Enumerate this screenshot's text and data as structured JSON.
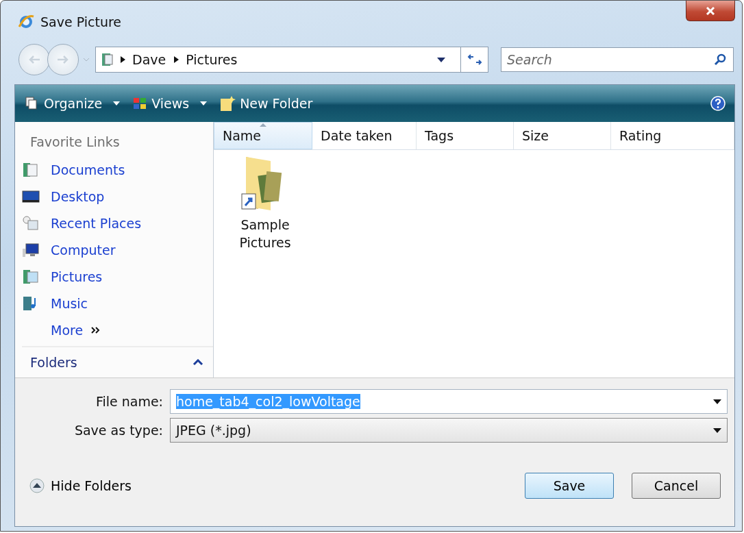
{
  "window": {
    "title": "Save Picture"
  },
  "address": {
    "path": [
      "Dave",
      "Pictures"
    ]
  },
  "search": {
    "placeholder": "Search"
  },
  "toolbar": [
    {
      "kind": "organize",
      "label": "Organize"
    },
    {
      "kind": "views",
      "label": "Views"
    },
    {
      "kind": "new-folder",
      "label": "New Folder"
    }
  ],
  "sidebar": {
    "heading": "Favorite Links",
    "items": [
      {
        "kind": "documents",
        "label": "Documents"
      },
      {
        "kind": "desktop",
        "label": "Desktop"
      },
      {
        "kind": "recent",
        "label": "Recent Places"
      },
      {
        "kind": "computer",
        "label": "Computer"
      },
      {
        "kind": "pictures",
        "label": "Pictures"
      },
      {
        "kind": "music",
        "label": "Music"
      }
    ],
    "more": "More",
    "folders": "Folders",
    "folders_expanded": true
  },
  "columns": [
    {
      "label": "Name",
      "sorted": true
    },
    {
      "label": "Date taken",
      "sorted": false
    },
    {
      "label": "Tags",
      "sorted": false
    },
    {
      "label": "Size",
      "sorted": false
    },
    {
      "label": "Rating",
      "sorted": false
    }
  ],
  "files": [
    {
      "name": "Sample Pictures"
    }
  ],
  "file_name": {
    "label": "File name:",
    "value": "home_tab4_col2_lowVoltage",
    "value_selected": true
  },
  "save_as_type": {
    "label": "Save as type:",
    "value": "JPEG (*.jpg)"
  },
  "hide_folders": "Hide Folders",
  "buttons": [
    {
      "label": "Save",
      "default": true
    },
    {
      "label": "Cancel",
      "default": false
    }
  ]
}
